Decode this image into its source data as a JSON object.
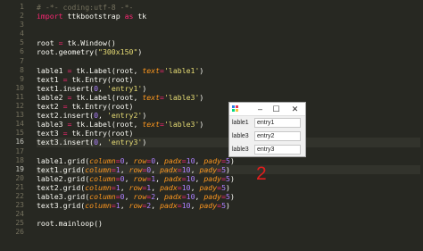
{
  "editor": {
    "line_numbers": [
      "1",
      "2",
      "3",
      "4",
      "5",
      "6",
      "7",
      "8",
      "9",
      "10",
      "11",
      "12",
      "13",
      "14",
      "15",
      "16",
      "17",
      "18",
      "19",
      "20",
      "21",
      "22",
      "23",
      "24",
      "25",
      "26"
    ],
    "current_lines": [
      16,
      19
    ],
    "code_lines": [
      [
        {
          "t": "# -*- coding:utf-8 -*-",
          "c": "comment"
        }
      ],
      [
        {
          "t": "import",
          "c": "keyword"
        },
        {
          "t": " ttkbootstrap ",
          "c": "plain"
        },
        {
          "t": "as",
          "c": "keyword"
        },
        {
          "t": " tk",
          "c": "plain"
        }
      ],
      [],
      [],
      [
        {
          "t": "root ",
          "c": "plain"
        },
        {
          "t": "=",
          "c": "op"
        },
        {
          "t": " tk.Window()",
          "c": "plain"
        }
      ],
      [
        {
          "t": "root.geometry(",
          "c": "plain"
        },
        {
          "t": "\"300x150\"",
          "c": "string"
        },
        {
          "t": ")",
          "c": "plain"
        }
      ],
      [],
      [
        {
          "t": "lable1 ",
          "c": "plain"
        },
        {
          "t": "=",
          "c": "op"
        },
        {
          "t": " tk.Label(root, ",
          "c": "plain"
        },
        {
          "t": "text",
          "c": "kw"
        },
        {
          "t": "=",
          "c": "op"
        },
        {
          "t": "'lable1'",
          "c": "string"
        },
        {
          "t": ")",
          "c": "plain"
        }
      ],
      [
        {
          "t": "text1 ",
          "c": "plain"
        },
        {
          "t": "=",
          "c": "op"
        },
        {
          "t": " tk.Entry(root)",
          "c": "plain"
        }
      ],
      [
        {
          "t": "text1.insert(",
          "c": "plain"
        },
        {
          "t": "0",
          "c": "number"
        },
        {
          "t": ", ",
          "c": "plain"
        },
        {
          "t": "'entry1'",
          "c": "string"
        },
        {
          "t": ")",
          "c": "plain"
        }
      ],
      [
        {
          "t": "lable2 ",
          "c": "plain"
        },
        {
          "t": "=",
          "c": "op"
        },
        {
          "t": " tk.Label(root, ",
          "c": "plain"
        },
        {
          "t": "text",
          "c": "kw"
        },
        {
          "t": "=",
          "c": "op"
        },
        {
          "t": "'lable3'",
          "c": "string"
        },
        {
          "t": ")",
          "c": "plain"
        }
      ],
      [
        {
          "t": "text2 ",
          "c": "plain"
        },
        {
          "t": "=",
          "c": "op"
        },
        {
          "t": " tk.Entry(root)",
          "c": "plain"
        }
      ],
      [
        {
          "t": "text2.insert(",
          "c": "plain"
        },
        {
          "t": "0",
          "c": "number"
        },
        {
          "t": ", ",
          "c": "plain"
        },
        {
          "t": "'entry2'",
          "c": "string"
        },
        {
          "t": ")",
          "c": "plain"
        }
      ],
      [
        {
          "t": "lable3 ",
          "c": "plain"
        },
        {
          "t": "=",
          "c": "op"
        },
        {
          "t": " tk.Label(root, ",
          "c": "plain"
        },
        {
          "t": "text",
          "c": "kw"
        },
        {
          "t": "=",
          "c": "op"
        },
        {
          "t": "'lable3'",
          "c": "string"
        },
        {
          "t": ")",
          "c": "plain"
        }
      ],
      [
        {
          "t": "text3 ",
          "c": "plain"
        },
        {
          "t": "=",
          "c": "op"
        },
        {
          "t": " tk.Entry(root)",
          "c": "plain"
        }
      ],
      [
        {
          "t": "text3.insert(",
          "c": "plain"
        },
        {
          "t": "0",
          "c": "number"
        },
        {
          "t": ", ",
          "c": "plain"
        },
        {
          "t": "'entry3'",
          "c": "string"
        },
        {
          "t": ")",
          "c": "plain"
        }
      ],
      [],
      [
        {
          "t": "lable1.grid(",
          "c": "plain"
        },
        {
          "t": "column",
          "c": "kw"
        },
        {
          "t": "=",
          "c": "op"
        },
        {
          "t": "0",
          "c": "number"
        },
        {
          "t": ", ",
          "c": "plain"
        },
        {
          "t": "row",
          "c": "kw"
        },
        {
          "t": "=",
          "c": "op"
        },
        {
          "t": "0",
          "c": "number"
        },
        {
          "t": ", ",
          "c": "plain"
        },
        {
          "t": "padx",
          "c": "kw"
        },
        {
          "t": "=",
          "c": "op"
        },
        {
          "t": "10",
          "c": "number"
        },
        {
          "t": ", ",
          "c": "plain"
        },
        {
          "t": "pady",
          "c": "kw"
        },
        {
          "t": "=",
          "c": "op"
        },
        {
          "t": "5",
          "c": "number"
        },
        {
          "t": ")",
          "c": "plain"
        }
      ],
      [
        {
          "t": "text1.grid(",
          "c": "plain"
        },
        {
          "t": "column",
          "c": "kw"
        },
        {
          "t": "=",
          "c": "op"
        },
        {
          "t": "1",
          "c": "number"
        },
        {
          "t": ", ",
          "c": "plain"
        },
        {
          "t": "row",
          "c": "kw"
        },
        {
          "t": "=",
          "c": "op"
        },
        {
          "t": "0",
          "c": "number"
        },
        {
          "t": ", ",
          "c": "plain"
        },
        {
          "t": "padx",
          "c": "kw"
        },
        {
          "t": "=",
          "c": "op"
        },
        {
          "t": "10",
          "c": "number"
        },
        {
          "t": ", ",
          "c": "plain"
        },
        {
          "t": "pady",
          "c": "kw"
        },
        {
          "t": "=",
          "c": "op"
        },
        {
          "t": "5",
          "c": "number"
        },
        {
          "t": ")",
          "c": "plain"
        }
      ],
      [
        {
          "t": "lable2.grid(",
          "c": "plain"
        },
        {
          "t": "column",
          "c": "kw"
        },
        {
          "t": "=",
          "c": "op"
        },
        {
          "t": "0",
          "c": "number"
        },
        {
          "t": ", ",
          "c": "plain"
        },
        {
          "t": "row",
          "c": "kw"
        },
        {
          "t": "=",
          "c": "op"
        },
        {
          "t": "1",
          "c": "number"
        },
        {
          "t": ", ",
          "c": "plain"
        },
        {
          "t": "padx",
          "c": "kw"
        },
        {
          "t": "=",
          "c": "op"
        },
        {
          "t": "10",
          "c": "number"
        },
        {
          "t": ", ",
          "c": "plain"
        },
        {
          "t": "pady",
          "c": "kw"
        },
        {
          "t": "=",
          "c": "op"
        },
        {
          "t": "5",
          "c": "number"
        },
        {
          "t": ")",
          "c": "plain"
        }
      ],
      [
        {
          "t": "text2.grid(",
          "c": "plain"
        },
        {
          "t": "column",
          "c": "kw"
        },
        {
          "t": "=",
          "c": "op"
        },
        {
          "t": "1",
          "c": "number"
        },
        {
          "t": ", ",
          "c": "plain"
        },
        {
          "t": "row",
          "c": "kw"
        },
        {
          "t": "=",
          "c": "op"
        },
        {
          "t": "1",
          "c": "number"
        },
        {
          "t": ", ",
          "c": "plain"
        },
        {
          "t": "padx",
          "c": "kw"
        },
        {
          "t": "=",
          "c": "op"
        },
        {
          "t": "10",
          "c": "number"
        },
        {
          "t": ", ",
          "c": "plain"
        },
        {
          "t": "pady",
          "c": "kw"
        },
        {
          "t": "=",
          "c": "op"
        },
        {
          "t": "5",
          "c": "number"
        },
        {
          "t": ")",
          "c": "plain"
        }
      ],
      [
        {
          "t": "lable3.grid(",
          "c": "plain"
        },
        {
          "t": "column",
          "c": "kw"
        },
        {
          "t": "=",
          "c": "op"
        },
        {
          "t": "0",
          "c": "number"
        },
        {
          "t": ", ",
          "c": "plain"
        },
        {
          "t": "row",
          "c": "kw"
        },
        {
          "t": "=",
          "c": "op"
        },
        {
          "t": "2",
          "c": "number"
        },
        {
          "t": ", ",
          "c": "plain"
        },
        {
          "t": "padx",
          "c": "kw"
        },
        {
          "t": "=",
          "c": "op"
        },
        {
          "t": "10",
          "c": "number"
        },
        {
          "t": ", ",
          "c": "plain"
        },
        {
          "t": "pady",
          "c": "kw"
        },
        {
          "t": "=",
          "c": "op"
        },
        {
          "t": "5",
          "c": "number"
        },
        {
          "t": ")",
          "c": "plain"
        }
      ],
      [
        {
          "t": "text3.grid(",
          "c": "plain"
        },
        {
          "t": "column",
          "c": "kw"
        },
        {
          "t": "=",
          "c": "op"
        },
        {
          "t": "1",
          "c": "number"
        },
        {
          "t": ", ",
          "c": "plain"
        },
        {
          "t": "row",
          "c": "kw"
        },
        {
          "t": "=",
          "c": "op"
        },
        {
          "t": "2",
          "c": "number"
        },
        {
          "t": ", ",
          "c": "plain"
        },
        {
          "t": "padx",
          "c": "kw"
        },
        {
          "t": "=",
          "c": "op"
        },
        {
          "t": "10",
          "c": "number"
        },
        {
          "t": ", ",
          "c": "plain"
        },
        {
          "t": "pady",
          "c": "kw"
        },
        {
          "t": "=",
          "c": "op"
        },
        {
          "t": "5",
          "c": "number"
        },
        {
          "t": ")",
          "c": "plain"
        }
      ],
      [],
      [
        {
          "t": "root.mainloop()",
          "c": "plain"
        }
      ],
      []
    ],
    "colors": {
      "background": "#272822",
      "comment": "#75715e",
      "keyword": "#f92672",
      "string": "#e6db74",
      "number": "#ae81ff",
      "kwarg": "#fd971f",
      "text": "#f8f8f2"
    }
  },
  "tk_window": {
    "controls": {
      "minimize": "–",
      "maximize": "☐",
      "close": "✕"
    },
    "rows": [
      {
        "label": "lable1",
        "entry": "entry1"
      },
      {
        "label": "lable3",
        "entry": "entry2"
      },
      {
        "label": "lable3",
        "entry": "entry3"
      }
    ],
    "icon": "feather-icon"
  },
  "annotation": {
    "text": "2",
    "color": "#e01e1e"
  }
}
